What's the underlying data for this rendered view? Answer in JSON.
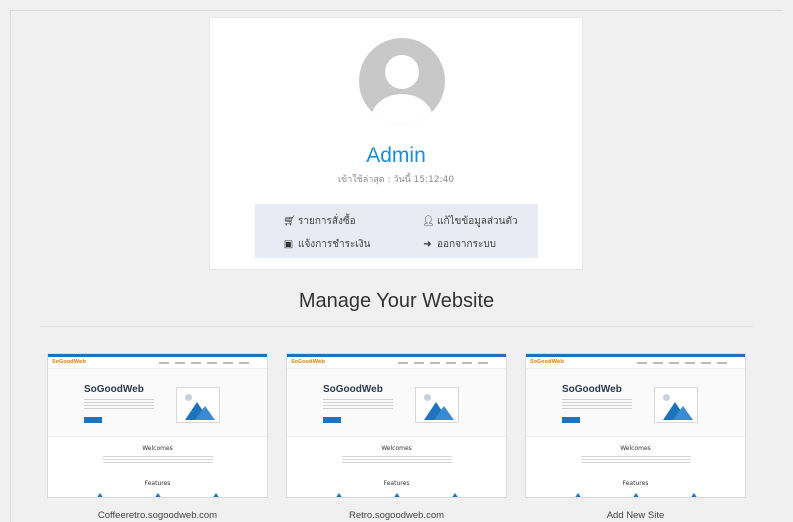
{
  "profile": {
    "username": "Admin",
    "last_login": "เข้าใช้ล่าสุด : วันนี้ 15:12:40",
    "menu": {
      "orders": {
        "label": "รายการสั่งซื้อ",
        "icon": "shopping-cart-icon"
      },
      "edit_profile": {
        "label": "แก้ไขข้อมูลส่วนตัว",
        "icon": "user-icon"
      },
      "payment": {
        "label": "แจ้งการชำระเงิน",
        "icon": "money-icon"
      },
      "logout": {
        "label": "ออกจากระบบ",
        "icon": "sign-out-icon"
      }
    }
  },
  "websites": {
    "title": "Manage Your Website",
    "thumbnail": {
      "logo": "SoGoodWeb",
      "brand": "SoGoodWeb",
      "welcome": "Welcomes",
      "features": "Features"
    },
    "sites": [
      {
        "caption": "Coffeeretro.sogoodweb.com"
      },
      {
        "caption": "Retro.sogoodweb.com"
      },
      {
        "caption": "Add New Site"
      }
    ]
  },
  "colors": {
    "accent": "#1a8fd6",
    "background": "#f0f0f0",
    "menu_bg": "#e8ebf3",
    "thumb_blue": "#1e73be"
  }
}
